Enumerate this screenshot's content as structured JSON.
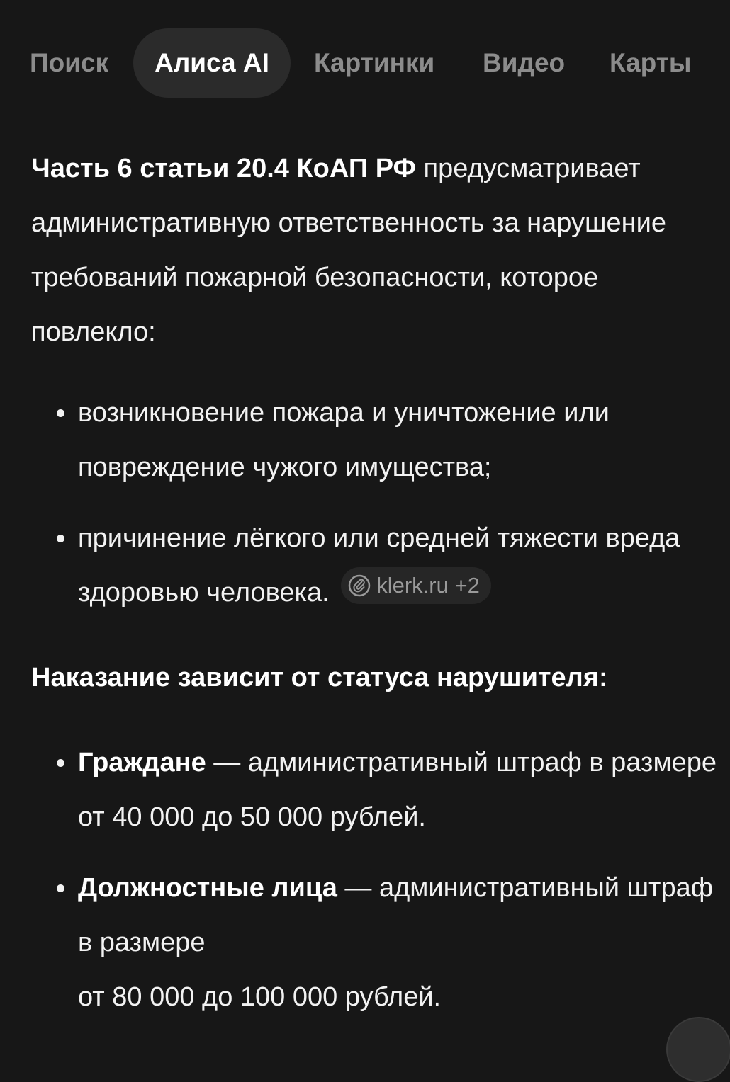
{
  "tabs": [
    {
      "label": "Поиск",
      "active": false
    },
    {
      "label": "Алиса AI",
      "active": true
    },
    {
      "label": "Картинки",
      "active": false
    },
    {
      "label": "Видео",
      "active": false
    },
    {
      "label": "Карты",
      "active": false
    }
  ],
  "answer": {
    "intro_bold": "Часть 6 статьи 20.4 КоАП РФ",
    "intro_text": " предусматривает административную ответственность за нарушение требований пожарной безопасности, которое повлекло:",
    "consequences": [
      "возникновение пожара и уничтожение или повреждение чужого имущества;",
      "причинение лёгкого или средней тяжести вреда здоровью человека."
    ],
    "source_chip": "klerk.ru +2",
    "penalty_heading": "Наказание зависит от статуса нарушителя:",
    "penalties": [
      {
        "who": "Граждане",
        "text": " — административный штраф в размере от 40 000 до 50 000 рублей."
      },
      {
        "who": "Должностные лица",
        "text": " — административный штраф в размере",
        "text2": "от 80 000 до 100 000 рублей."
      }
    ]
  },
  "colors": {
    "background": "#171717",
    "text": "#f2f2f2",
    "tab_inactive": "#8c8c8c",
    "tab_active_bg": "#2b2b2b",
    "chip_bg": "#262626"
  }
}
